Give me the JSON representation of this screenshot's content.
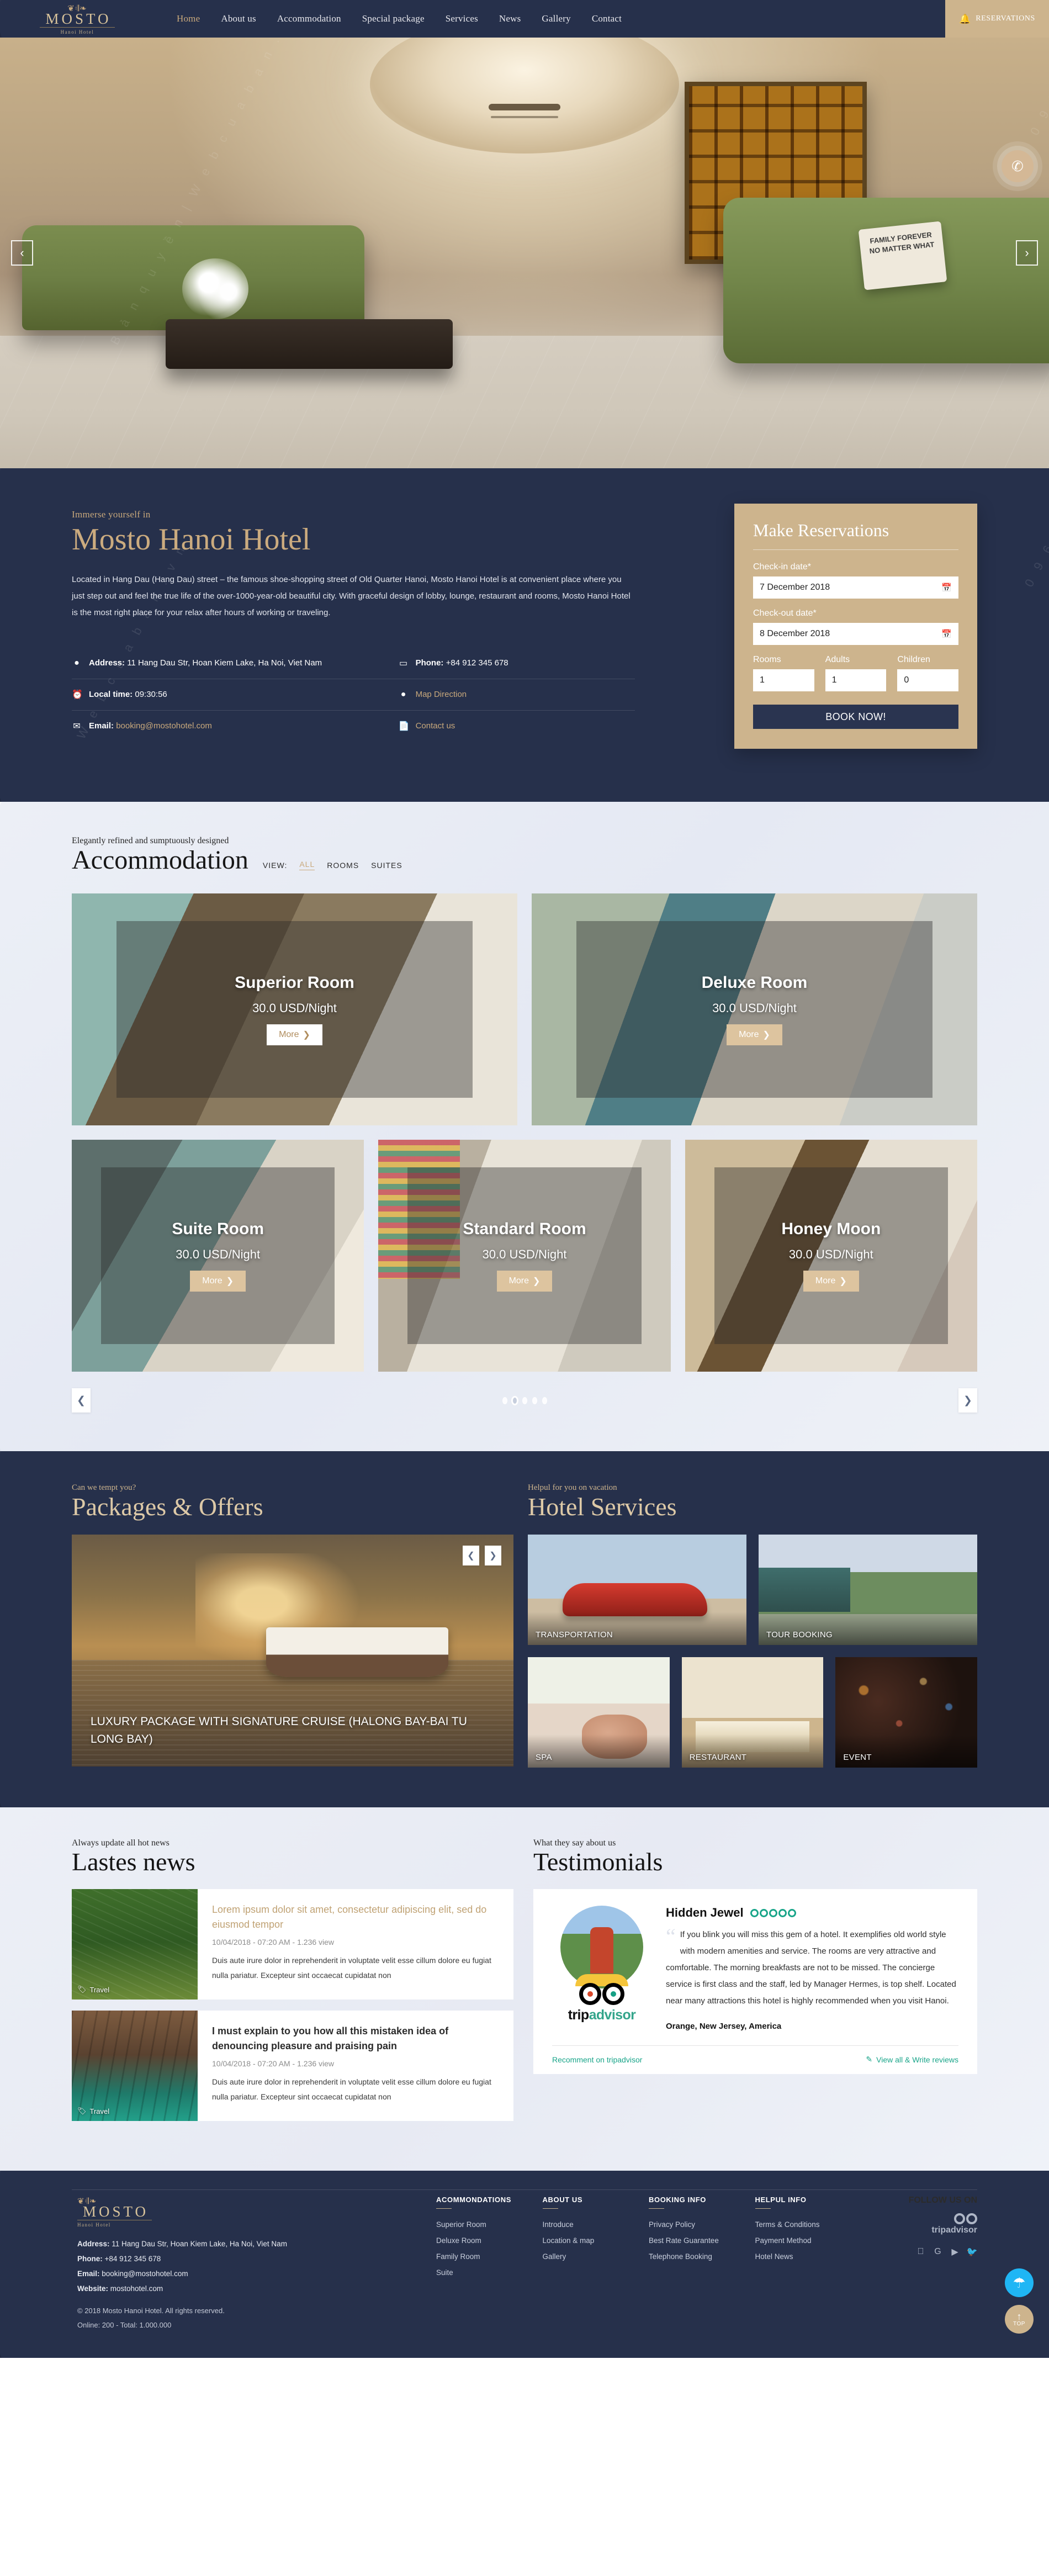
{
  "brand": {
    "ornament": "❦",
    "name": "MOSTO",
    "tagline": "Hanoi Hotel"
  },
  "nav": {
    "items": [
      {
        "label": "Home",
        "active": true
      },
      {
        "label": "About us",
        "active": false
      },
      {
        "label": "Accommodation",
        "active": false
      },
      {
        "label": "Special package",
        "active": false
      },
      {
        "label": "Services",
        "active": false
      },
      {
        "label": "News",
        "active": false
      },
      {
        "label": "Gallery",
        "active": false
      },
      {
        "label": "Contact",
        "active": false
      }
    ],
    "reservations_label": "RESERVATIONS",
    "bell_icon": "bell-icon"
  },
  "hero": {
    "prev_icon": "‹",
    "next_icon": "›",
    "call_icon": "✆",
    "pillow_text": "FAMILY FOREVER NO MATTER WHAT"
  },
  "intro": {
    "eyebrow": "Immerse yourself in",
    "title": "Mosto Hanoi Hotel",
    "body": "Located in Hang Dau (Hang Dau) street – the famous shoe-shopping street of Old Quarter Hanoi, Mosto Hanoi Hotel is at convenient place where you just step out and feel the true life of the over-1000-year-old beautiful city. With graceful design of lobby, lounge, restaurant and rooms, Mosto Hanoi Hotel is the most right place for your relax after hours of working or traveling.",
    "address_label": "Address:",
    "address_value": "11 Hang Dau Str, Hoan Kiem Lake, Ha Noi, Viet Nam",
    "phone_label": "Phone:",
    "phone_value": "+84 912 345 678",
    "localtime_label": "Local time:",
    "localtime_value": "09:30:56",
    "map_direction": "Map Direction",
    "email_label": "Email:",
    "email_value": "booking@mostohotel.com",
    "contact_us": "Contact us"
  },
  "reservation": {
    "title": "Make Reservations",
    "checkin_label": "Check-in date*",
    "checkin_value": "7 December 2018",
    "checkout_label": "Check-out date*",
    "checkout_value": "8 December 2018",
    "rooms_label": "Rooms",
    "rooms_value": "1",
    "adults_label": "Adults",
    "adults_value": "1",
    "children_label": "Children",
    "children_value": "0",
    "book_label": "BOOK NOW!",
    "calendar_icon": "calendar-icon"
  },
  "accommodation": {
    "eyebrow": "Elegantly refined and sumptuously designed",
    "title": "Accommodation",
    "view_label": "VIEW:",
    "filters": [
      {
        "label": "ALL",
        "active": true
      },
      {
        "label": "ROOMS",
        "active": false
      },
      {
        "label": "SUITES",
        "active": false
      }
    ],
    "rooms_row1": [
      {
        "name": "Superior Room",
        "price": "30.0 USD/Night",
        "more": "More"
      },
      {
        "name": "Deluxe Room",
        "price": "30.0 USD/Night",
        "more": "More"
      }
    ],
    "rooms_row2": [
      {
        "name": "Suite Room",
        "price": "30.0 USD/Night",
        "more": "More"
      },
      {
        "name": "Standard Room",
        "price": "30.0 USD/Night",
        "more": "More"
      },
      {
        "name": "Honey Moon",
        "price": "30.0 USD/Night",
        "more": "More"
      }
    ],
    "prev_icon": "❮",
    "next_icon": "❯",
    "dots_count": 5,
    "active_dot": 2
  },
  "packages": {
    "eyebrow": "Can we tempt you?",
    "title": "Packages & Offers",
    "caption": "LUXURY PACKAGE WITH SIGNATURE CRUISE (HALONG BAY-BAI TU LONG BAY)",
    "prev_icon": "❮",
    "next_icon": "❯"
  },
  "services": {
    "eyebrow": "Helpul for you on vacation",
    "title": "Hotel Services",
    "tiles_top": [
      {
        "label": "TRANSPORTATION"
      },
      {
        "label": "TOUR BOOKING"
      }
    ],
    "tiles_bottom": [
      {
        "label": "SPA"
      },
      {
        "label": "RESTAURANT"
      },
      {
        "label": "EVENT"
      }
    ]
  },
  "news": {
    "eyebrow": "Always update all hot news",
    "title": "Lastes news",
    "items": [
      {
        "tag": "Travel",
        "tag_icon": "tag-icon",
        "title": "Lorem ipsum dolor sit amet, consectetur adipiscing elit, sed do eiusmod tempor",
        "meta": "10/04/2018 - 07:20 AM  - 1.236 view",
        "excerpt": "Duis aute irure dolor in reprehenderit in voluptate velit esse cillum dolore eu fugiat nulla pariatur. Excepteur sint occaecat cupidatat non",
        "gold": true
      },
      {
        "tag": "Travel",
        "tag_icon": "tag-icon",
        "title": "I must explain to you how all this mistaken idea of denouncing pleasure and praising pain",
        "meta": "10/04/2018 - 07:20 AM  - 1.236 view",
        "excerpt": "Duis aute irure dolor in reprehenderit in voluptate velit esse cillum dolore eu fugiat nulla pariatur. Excepteur sint occaecat cupidatat non",
        "gold": false
      }
    ]
  },
  "testimonials": {
    "eyebrow": "What they say about us",
    "title": "Testimonials",
    "review": {
      "name": "Hidden Jewel",
      "rating": 5,
      "quote_icon": "quote-icon",
      "text": "If you blink you will miss this gem of a hotel. It exemplifies old world style with modern amenities and service. The rooms are very attractive and comfortable. The morning breakfasts are not to be missed. The concierge service is first class and the staff, led by Manager Hermes, is top shelf. Located near many attractions this hotel is highly recommended when you visit Hanoi.",
      "location": "Orange, New Jersey, America",
      "brand_a": "trip",
      "brand_b": "advisor"
    },
    "recommend_link": "Recomment on tripadvisor",
    "viewall_link": "View all & Write reviews",
    "pencil_icon": "pencil-icon"
  },
  "footer": {
    "address_label": "Address:",
    "address_value": "11 Hang Dau Str, Hoan Kiem Lake, Ha Noi, Viet Nam",
    "phone_label": "Phone:",
    "phone_value": "+84 912 345 678",
    "email_label": "Email:",
    "email_value": "booking@mostohotel.com",
    "website_label": "Website:",
    "website_value": "mostohotel.com",
    "copyright": "© 2018 Mosto Hanoi Hotel. All rights reserved.",
    "stats": "Online: 200 - Total: 1.000.000",
    "columns": [
      {
        "heading": "ACOMMONDATIONS",
        "links": [
          "Superior Room",
          "Deluxe Room",
          "Family Room",
          "Suite"
        ]
      },
      {
        "heading": "ABOUT US",
        "links": [
          "Introduce",
          "Location & map",
          "Gallery"
        ]
      },
      {
        "heading": "BOOKING INFO",
        "links": [
          "Privacy Policy",
          "Best Rate Guarantee",
          "Telephone Booking"
        ]
      },
      {
        "heading": "HELPUL INFO",
        "links": [
          "Terms & Conditions",
          "Payment Method",
          "Hotel News"
        ]
      }
    ],
    "follow_heading": "FOLLOW US ON",
    "ta_brand": "tripadvisor",
    "socials": [
      "facebook-icon",
      "google-icon",
      "youtube-icon",
      "twitter-icon"
    ],
    "social_glyphs": [
      "f",
      "G",
      "▶",
      "🐦"
    ],
    "fab_messenger_icon": "messenger-icon",
    "fab_top_label": "TOP",
    "fab_top_icon": "arrow-up-icon"
  },
  "watermarks": {
    "w1": "0 9 6 3 . 2 3 9 . 2 2 2",
    "w2": "W e b c u a b a n . v n",
    "w3": "B ả n  q u y ề n  |  W e b c u a b a n . v n"
  }
}
